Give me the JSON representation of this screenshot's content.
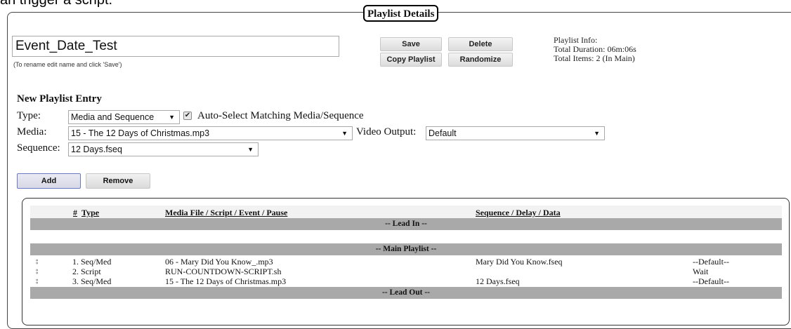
{
  "clipped_text": "an trigger a script.",
  "panel": {
    "title": "Playlist Details"
  },
  "playlist": {
    "name": "Event_Date_Test",
    "hint": "(To rename edit name and click 'Save')"
  },
  "buttons": {
    "save": "Save",
    "delete": "Delete",
    "copy": "Copy Playlist",
    "randomize": "Randomize",
    "add": "Add",
    "remove": "Remove"
  },
  "info": {
    "heading": "Playlist Info:",
    "duration": "Total Duration: 06m:06s",
    "items": "Total Items: 2 (In Main)"
  },
  "entry": {
    "title": "New Playlist Entry",
    "type_label": "Type:",
    "type_value": "Media and Sequence",
    "auto_select_label": "Auto-Select Matching Media/Sequence",
    "auto_select_checked": true,
    "media_label": "Media:",
    "media_value": "15 - The 12 Days of Christmas.mp3",
    "video_output_label": "Video Output:",
    "video_output_value": "Default",
    "sequence_label": "Sequence:",
    "sequence_value": "12 Days.fseq"
  },
  "table": {
    "columns": {
      "num": "#",
      "type": "Type",
      "media": "Media File / Script / Event / Pause",
      "sequence": "Sequence / Delay / Data"
    },
    "lead_in": "-- Lead In --",
    "main": "-- Main Playlist --",
    "lead_out": "-- Lead Out --",
    "rows": [
      {
        "num_type": "1. Seq/Med",
        "media": "06 - Mary Did You Know_.mp3",
        "sequence": "Mary Did You Know.fseq",
        "extra": "--Default--"
      },
      {
        "num_type": "2. Script",
        "media": "RUN-COUNTDOWN-SCRIPT.sh",
        "sequence": "",
        "extra": "Wait"
      },
      {
        "num_type": "3. Seq/Med",
        "media": "15 - The 12 Days of Christmas.mp3",
        "sequence": "12 Days.fseq",
        "extra": "--Default--"
      }
    ]
  },
  "icons": {
    "drag_handle": "drag-handle-icon",
    "dropdown": "chevron-down-icon",
    "check": "check-icon"
  }
}
